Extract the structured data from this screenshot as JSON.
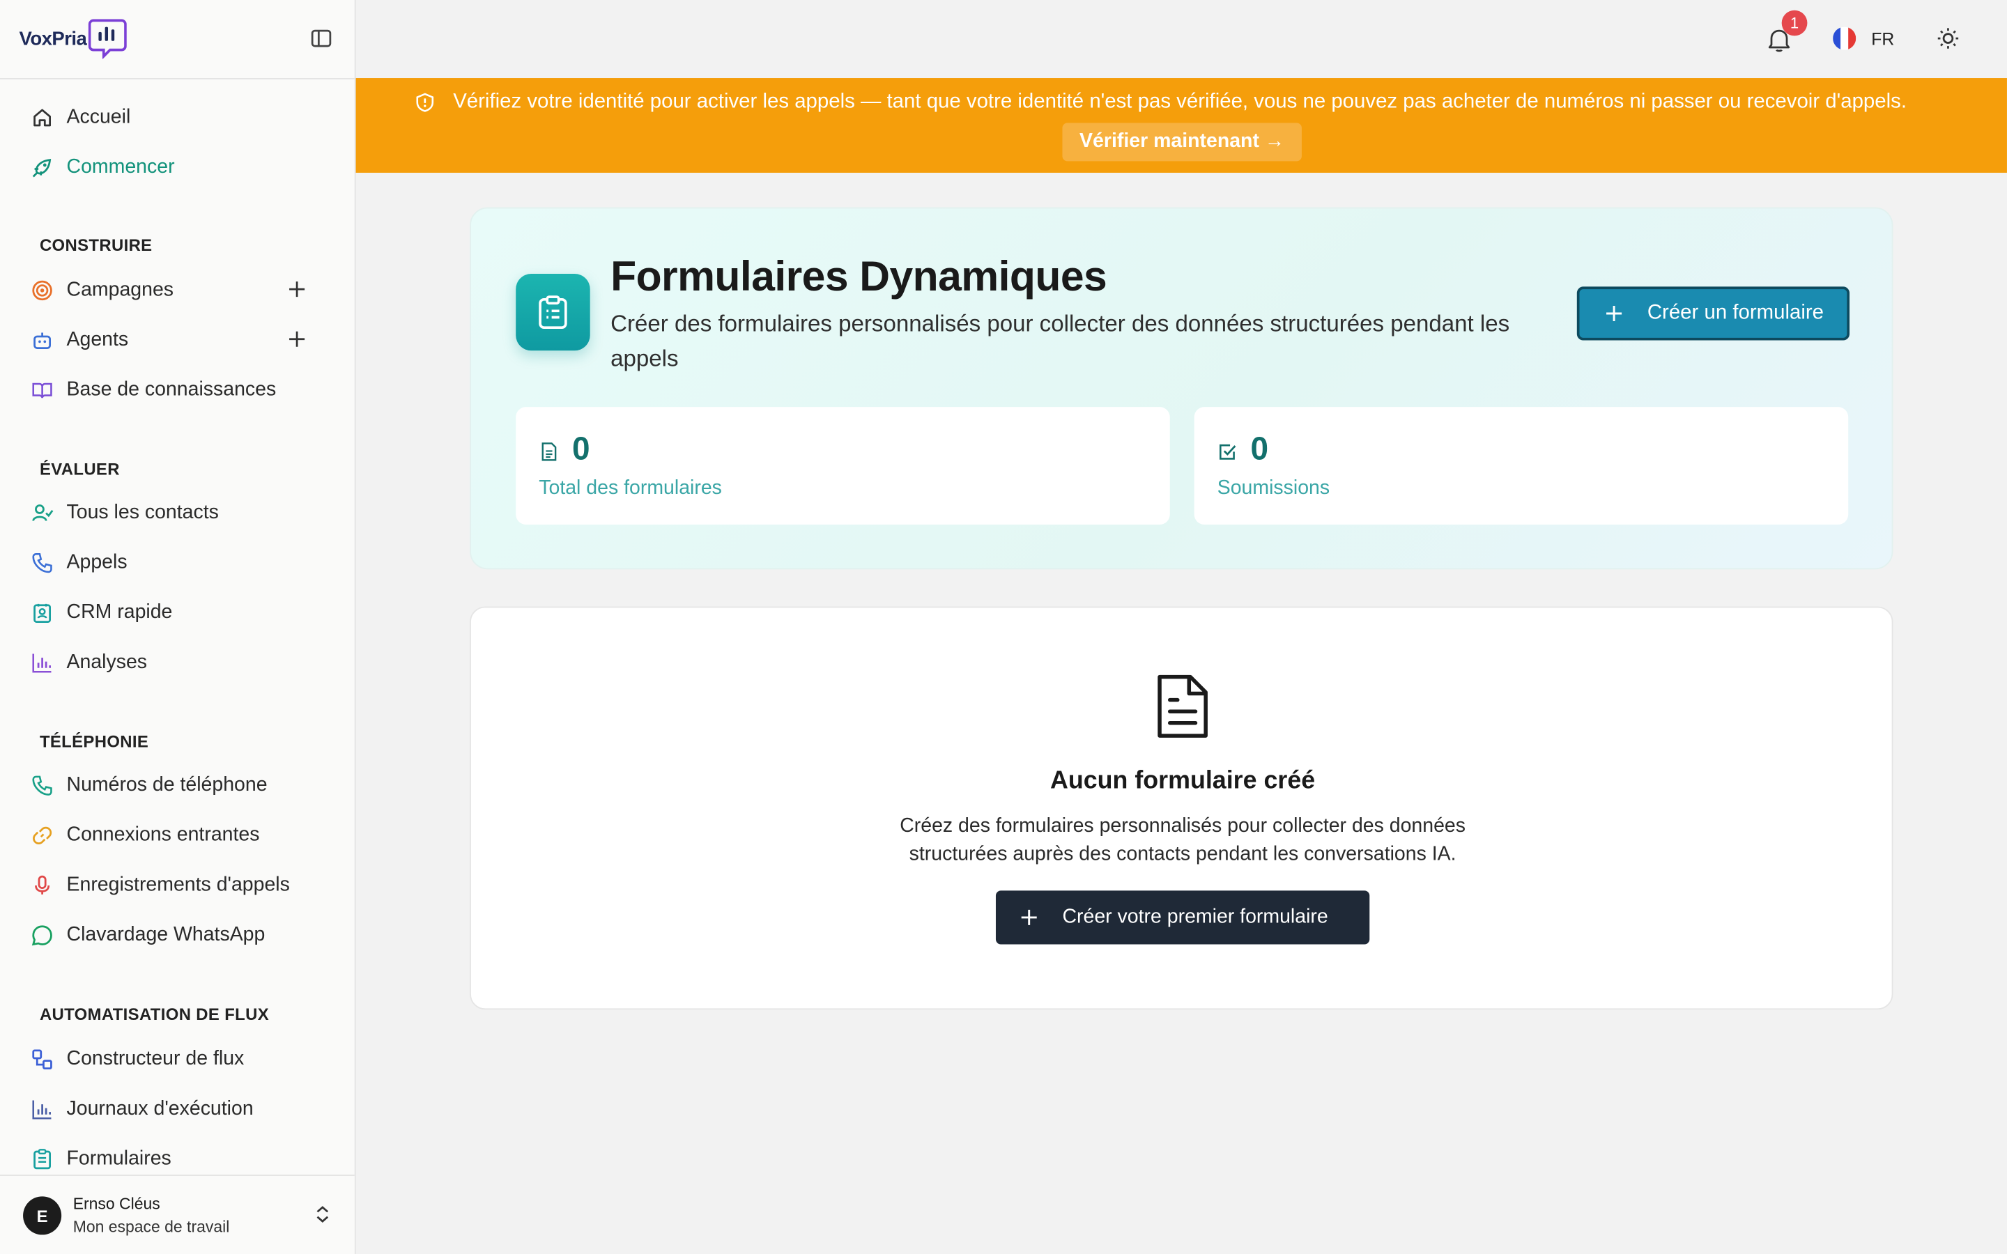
{
  "app": {
    "logo_text": "VoxPria"
  },
  "colors": {
    "accent_teal": "#12927b",
    "banner_orange": "#f59e0b",
    "primary_button": "#1a8bb0",
    "dark_button": "#1f2937",
    "badge_red": "#e5484d"
  },
  "sidebar": {
    "top_items": [
      {
        "label": "Accueil",
        "icon": "home-icon"
      },
      {
        "label": "Commencer",
        "icon": "rocket-icon",
        "active": true
      }
    ],
    "sections": [
      {
        "title": "CONSTRUIRE",
        "items": [
          {
            "label": "Campagnes",
            "icon": "target-icon"
          },
          {
            "label": "Agents",
            "icon": "bot-icon"
          },
          {
            "label": "Base de connaissances",
            "icon": "book-icon"
          }
        ]
      },
      {
        "title": "ÉVALUER",
        "items": [
          {
            "label": "Tous les contacts",
            "icon": "users-icon"
          },
          {
            "label": "Appels",
            "icon": "phone-icon"
          },
          {
            "label": "CRM rapide",
            "icon": "contact-card-icon"
          },
          {
            "label": "Analyses",
            "icon": "bar-chart-icon"
          }
        ]
      },
      {
        "title": "TÉLÉPHONIE",
        "items": [
          {
            "label": "Numéros de téléphone",
            "icon": "phone-icon"
          },
          {
            "label": "Connexions entrantes",
            "icon": "link-icon"
          },
          {
            "label": "Enregistrements d'appels",
            "icon": "microphone-icon"
          },
          {
            "label": "Clavardage WhatsApp",
            "icon": "chat-bubble-icon"
          }
        ]
      },
      {
        "title": "AUTOMATISATION DE FLUX",
        "items": [
          {
            "label": "Constructeur de flux",
            "icon": "workflow-icon"
          },
          {
            "label": "Journaux d'exécution",
            "icon": "bar-chart-icon"
          },
          {
            "label": "Formulaires",
            "icon": "clipboard-icon"
          }
        ]
      }
    ],
    "user": {
      "initial": "E",
      "name": "Ernso Cléus",
      "workspace": "Mon espace de travail"
    }
  },
  "topbar": {
    "notification_count": "1",
    "language_code": "FR"
  },
  "banner": {
    "message": "Vérifiez votre identité pour activer les appels — tant que votre identité n'est pas vérifiée, vous ne pouvez pas acheter de numéros ni passer ou recevoir d'appels.",
    "button_label": "Vérifier maintenant →"
  },
  "hero": {
    "title": "Formulaires Dynamiques",
    "subtitle": "Créer des formulaires personnalisés pour collecter des données structurées pendant les appels",
    "create_button": "Créer un formulaire",
    "stats": [
      {
        "value": "0",
        "label": "Total des formulaires",
        "icon": "document-icon"
      },
      {
        "value": "0",
        "label": "Soumissions",
        "icon": "check-square-icon"
      }
    ]
  },
  "empty_state": {
    "title": "Aucun formulaire créé",
    "description": "Créez des formulaires personnalisés pour collecter des données structurées auprès des contacts pendant les conversations IA.",
    "button_label": "Créer votre premier formulaire"
  }
}
